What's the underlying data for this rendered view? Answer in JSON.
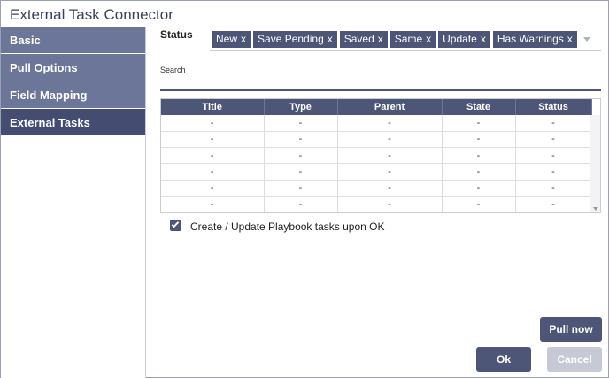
{
  "window": {
    "title": "External Task Connector"
  },
  "sidebar": {
    "items": [
      {
        "label": "Basic",
        "active": false
      },
      {
        "label": "Pull Options",
        "active": false
      },
      {
        "label": "Field Mapping",
        "active": false
      },
      {
        "label": "External Tasks",
        "active": true
      }
    ]
  },
  "status": {
    "label": "Status",
    "tags": [
      {
        "label": "New",
        "remove": "x"
      },
      {
        "label": "Save Pending",
        "remove": "x"
      },
      {
        "label": "Saved",
        "remove": "x"
      },
      {
        "label": "Same",
        "remove": "x"
      },
      {
        "label": "Update",
        "remove": "x"
      },
      {
        "label": "Has Warnings",
        "remove": "x"
      }
    ]
  },
  "search": {
    "label": "Search",
    "value": ""
  },
  "table": {
    "columns": [
      "Title",
      "Type",
      "Parent",
      "State",
      "Status"
    ],
    "rows": [
      [
        "-",
        "-",
        "-",
        "-",
        "-"
      ],
      [
        "-",
        "-",
        "-",
        "-",
        "-"
      ],
      [
        "-",
        "-",
        "-",
        "-",
        "-"
      ],
      [
        "-",
        "-",
        "-",
        "-",
        "-"
      ],
      [
        "-",
        "-",
        "-",
        "-",
        "-"
      ],
      [
        "-",
        "-",
        "-",
        "-",
        "-"
      ]
    ]
  },
  "options": {
    "create_update_label": "Create / Update Playbook tasks upon OK",
    "create_update_checked": true
  },
  "buttons": {
    "pull_now": "Pull now",
    "ok": "Ok",
    "cancel": "Cancel"
  }
}
